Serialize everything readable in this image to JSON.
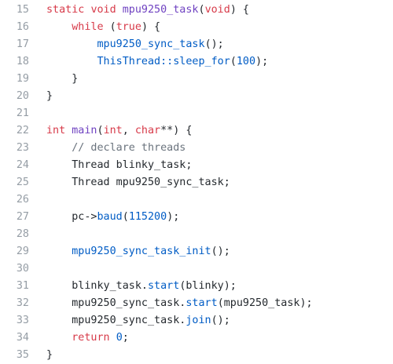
{
  "colors": {
    "keyword": "#d73a49",
    "function_name": "#6f42c1",
    "call": "#005cc5",
    "number": "#005cc5",
    "comment": "#6a737d",
    "text": "#24292e",
    "line_number": "#959da5",
    "background": "#ffffff"
  },
  "lines": [
    {
      "number": "15",
      "tokens": [
        {
          "t": "static",
          "c": "kw"
        },
        {
          "t": " "
        },
        {
          "t": "void",
          "c": "kw"
        },
        {
          "t": " "
        },
        {
          "t": "mpu9250_task",
          "c": "fn"
        },
        {
          "t": "("
        },
        {
          "t": "void",
          "c": "kw"
        },
        {
          "t": ") {"
        }
      ]
    },
    {
      "number": "16",
      "tokens": [
        {
          "t": "    "
        },
        {
          "t": "while",
          "c": "kw"
        },
        {
          "t": " ("
        },
        {
          "t": "true",
          "c": "kw"
        },
        {
          "t": ") {"
        }
      ]
    },
    {
      "number": "17",
      "tokens": [
        {
          "t": "        "
        },
        {
          "t": "mpu9250_sync_task",
          "c": "call"
        },
        {
          "t": "();"
        }
      ]
    },
    {
      "number": "18",
      "tokens": [
        {
          "t": "        "
        },
        {
          "t": "ThisThread::sleep_for",
          "c": "call"
        },
        {
          "t": "("
        },
        {
          "t": "100",
          "c": "num"
        },
        {
          "t": ");"
        }
      ]
    },
    {
      "number": "19",
      "tokens": [
        {
          "t": "    }"
        }
      ]
    },
    {
      "number": "20",
      "tokens": [
        {
          "t": "}"
        }
      ]
    },
    {
      "number": "21",
      "tokens": []
    },
    {
      "number": "22",
      "tokens": [
        {
          "t": "int",
          "c": "kw"
        },
        {
          "t": " "
        },
        {
          "t": "main",
          "c": "fn"
        },
        {
          "t": "("
        },
        {
          "t": "int",
          "c": "kw"
        },
        {
          "t": ", "
        },
        {
          "t": "char",
          "c": "kw"
        },
        {
          "t": "**) {"
        }
      ]
    },
    {
      "number": "23",
      "tokens": [
        {
          "t": "    "
        },
        {
          "t": "// declare threads",
          "c": "cmt"
        }
      ]
    },
    {
      "number": "24",
      "tokens": [
        {
          "t": "    Thread blinky_task;"
        }
      ]
    },
    {
      "number": "25",
      "tokens": [
        {
          "t": "    Thread mpu9250_sync_task;"
        }
      ]
    },
    {
      "number": "26",
      "tokens": []
    },
    {
      "number": "27",
      "tokens": [
        {
          "t": "    pc->"
        },
        {
          "t": "baud",
          "c": "call"
        },
        {
          "t": "("
        },
        {
          "t": "115200",
          "c": "num"
        },
        {
          "t": ");"
        }
      ]
    },
    {
      "number": "28",
      "tokens": []
    },
    {
      "number": "29",
      "tokens": [
        {
          "t": "    "
        },
        {
          "t": "mpu9250_sync_task_init",
          "c": "call"
        },
        {
          "t": "();"
        }
      ]
    },
    {
      "number": "30",
      "tokens": []
    },
    {
      "number": "31",
      "tokens": [
        {
          "t": "    blinky_task."
        },
        {
          "t": "start",
          "c": "call"
        },
        {
          "t": "(blinky);"
        }
      ]
    },
    {
      "number": "32",
      "tokens": [
        {
          "t": "    mpu9250_sync_task."
        },
        {
          "t": "start",
          "c": "call"
        },
        {
          "t": "(mpu9250_task);"
        }
      ]
    },
    {
      "number": "33",
      "tokens": [
        {
          "t": "    mpu9250_sync_task."
        },
        {
          "t": "join",
          "c": "call"
        },
        {
          "t": "();"
        }
      ]
    },
    {
      "number": "34",
      "tokens": [
        {
          "t": "    "
        },
        {
          "t": "return",
          "c": "kw"
        },
        {
          "t": " "
        },
        {
          "t": "0",
          "c": "num"
        },
        {
          "t": ";"
        }
      ]
    },
    {
      "number": "35",
      "tokens": [
        {
          "t": "}"
        }
      ]
    }
  ]
}
